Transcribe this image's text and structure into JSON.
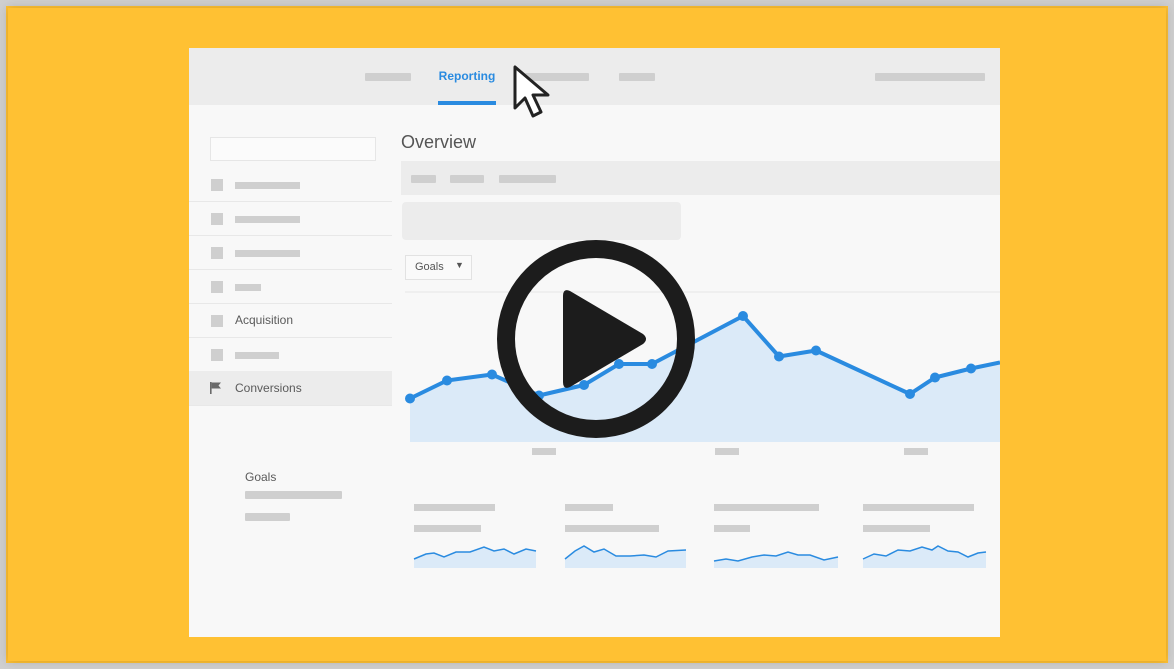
{
  "topbar": {
    "active_tab": "Reporting"
  },
  "sidebar": {
    "items": [
      {
        "label": "Acquisition"
      },
      {
        "label": "Conversions"
      }
    ],
    "sub_items": [
      {
        "label": "Goals"
      }
    ]
  },
  "main": {
    "title": "Overview",
    "goals_dropdown": "Goals",
    "caret": "▼"
  },
  "chart_data": {
    "type": "area",
    "x": [
      1,
      2,
      3,
      4,
      5,
      6,
      7,
      8,
      9,
      10,
      11,
      12,
      13,
      14,
      15
    ],
    "values": [
      29,
      41,
      45,
      31,
      38,
      52,
      52,
      84,
      57,
      61,
      32,
      43,
      49,
      53,
      53
    ],
    "ylim": [
      0,
      100
    ],
    "title": "",
    "xlabel": "",
    "ylabel": ""
  },
  "colors": {
    "background": "#ffc133",
    "accent": "#2a8be0",
    "area_fill": "#dbeaf8",
    "placeholder": "#cfcfcf"
  },
  "icons": {
    "play": "play-icon",
    "cursor": "cursor-icon",
    "flag": "flag-icon"
  }
}
